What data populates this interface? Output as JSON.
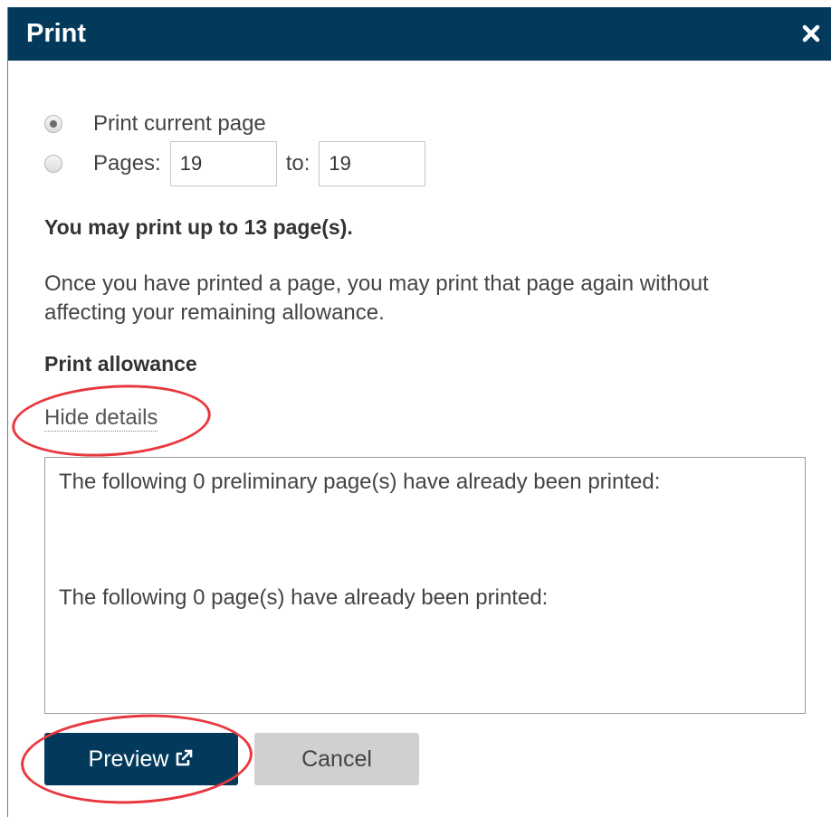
{
  "dialog": {
    "title": "Print",
    "close_icon": "close-icon"
  },
  "options": {
    "current_page_label": "Print current page",
    "pages_label": "Pages:",
    "from_value": "19",
    "to_label": "to:",
    "to_value": "19",
    "selected": "current_page"
  },
  "allowance_text": "You may print up to 13 page(s).",
  "info_text": "Once you have printed a page, you may print that page again without affecting your remaining allowance.",
  "allowance_heading": "Print allowance",
  "hide_details_label": "Hide details",
  "details": {
    "preliminary_text": "The following 0 preliminary page(s) have already been printed:",
    "pages_text": "The following 0 page(s) have already been printed:"
  },
  "buttons": {
    "preview_label": "Preview",
    "preview_icon": "external-link-icon",
    "cancel_label": "Cancel"
  },
  "colors": {
    "titlebar": "#033a5c",
    "primary_button": "#033a5c",
    "secondary_button": "#d0d0d0",
    "annotation": "#e8383f"
  }
}
